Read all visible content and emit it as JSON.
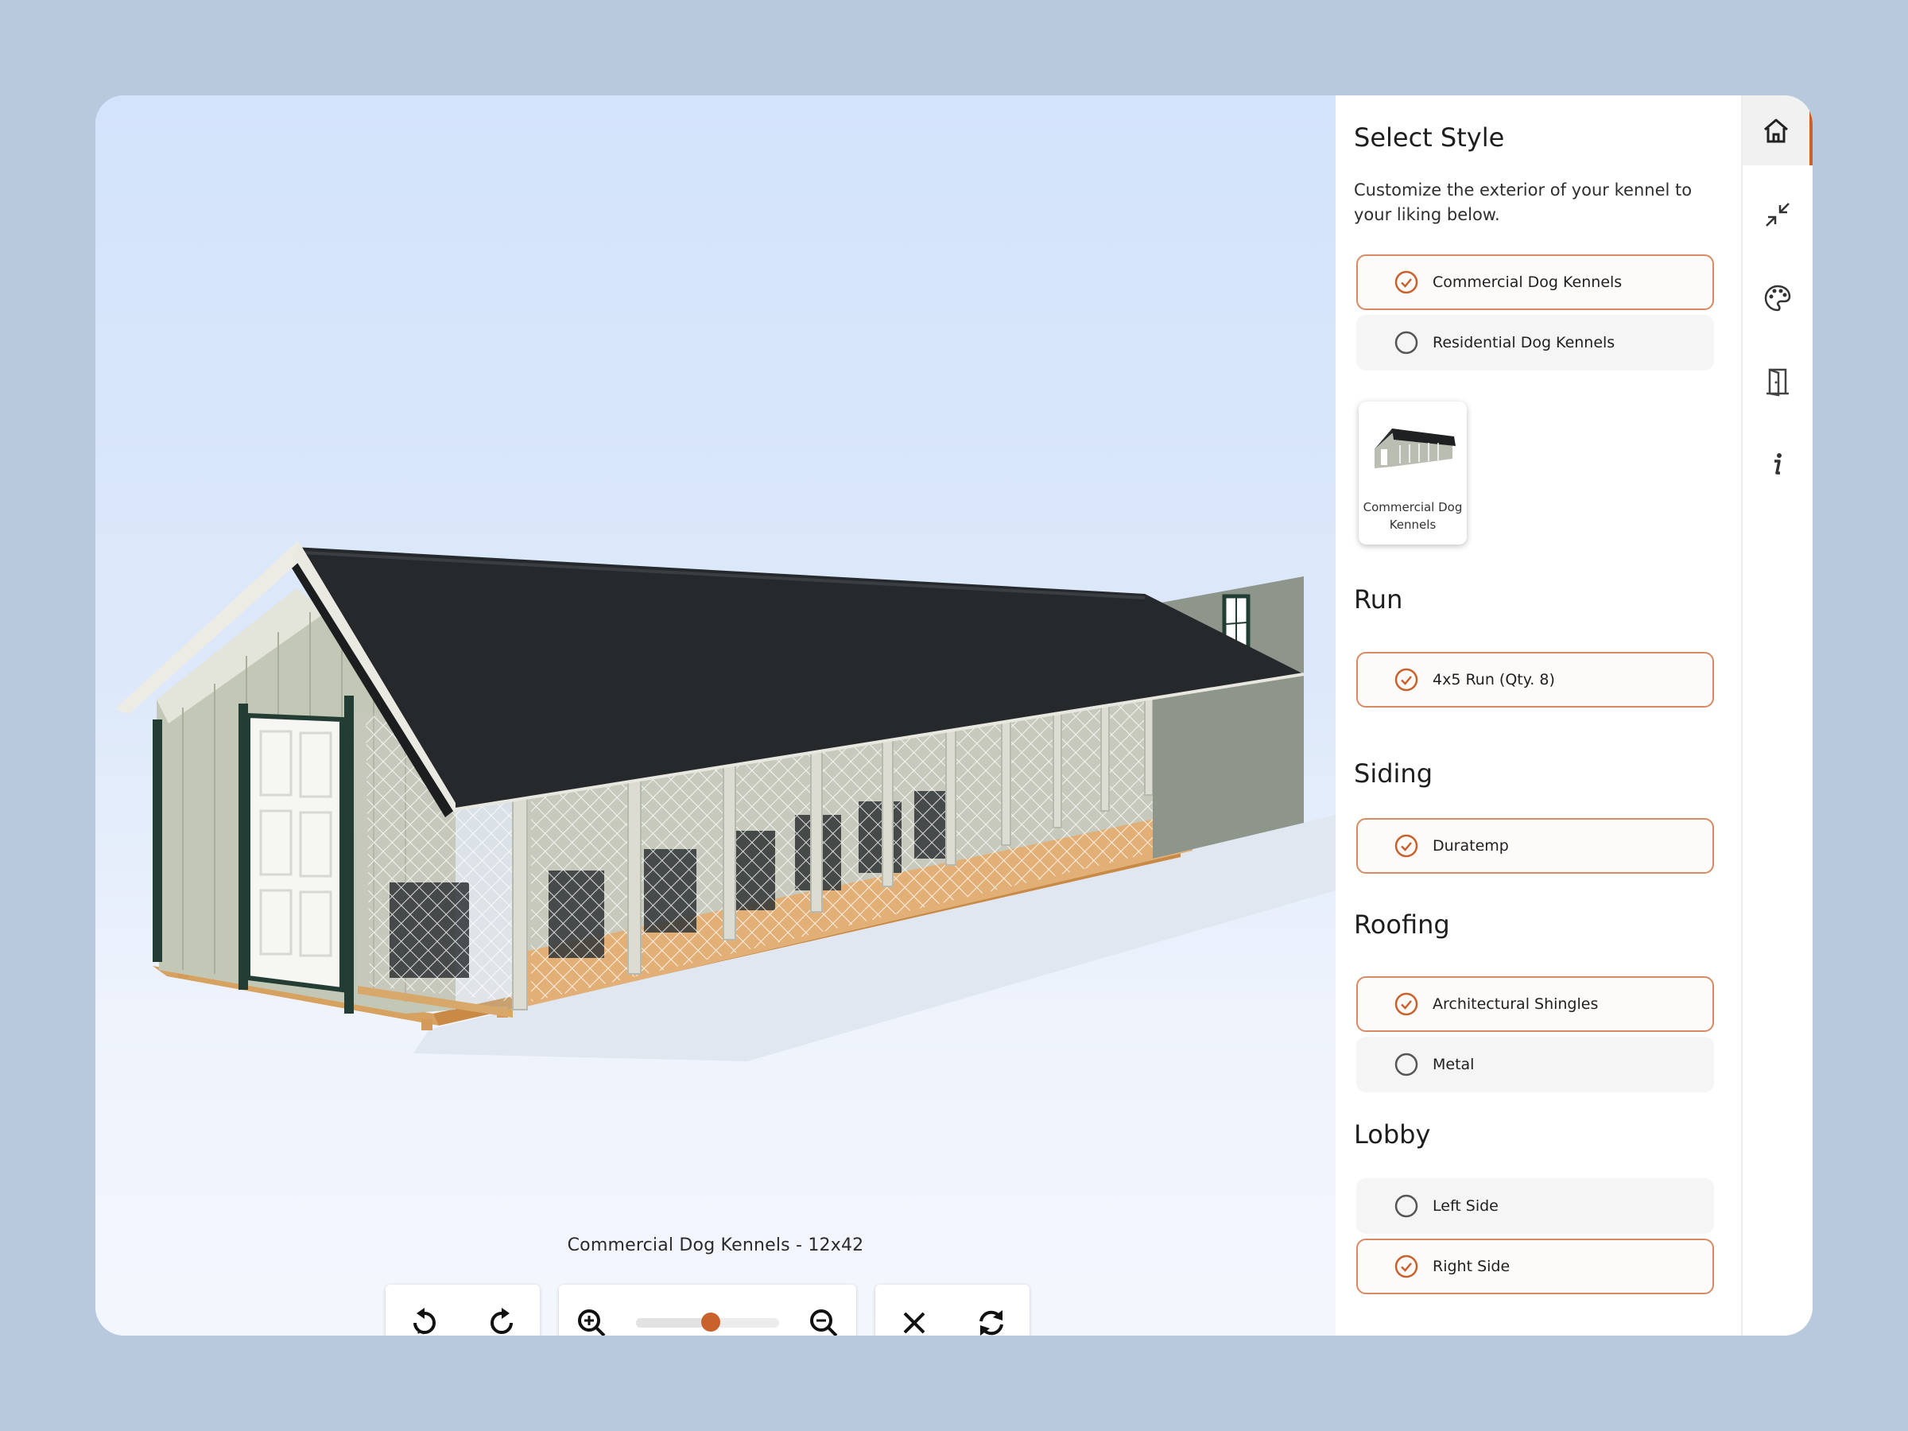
{
  "viewer": {
    "caption": "Commercial Dog Kennels - 12x42",
    "toolbar": {
      "rotate_left_icon": "rotate-left-icon",
      "rotate_right_icon": "rotate-right-icon",
      "zoom_in_icon": "zoom-in-icon",
      "zoom_out_icon": "zoom-out-icon",
      "zoom_level": 0.52,
      "close_icon": "close-icon",
      "reset_icon": "refresh-icon"
    }
  },
  "panel": {
    "style_title": "Select Style",
    "style_intro": "Customize the exterior of your kennel to your liking below.",
    "style_options": [
      {
        "label": "Commercial Dog Kennels",
        "selected": true
      },
      {
        "label": "Residential Dog Kennels",
        "selected": false
      }
    ],
    "model_thumb": {
      "label": "Commercial Dog Kennels"
    },
    "run": {
      "title": "Run",
      "options": [
        {
          "label": "4x5 Run (Qty. 8)",
          "selected": true
        }
      ]
    },
    "siding": {
      "title": "Siding",
      "options": [
        {
          "label": "Duratemp",
          "selected": true
        }
      ]
    },
    "roofing": {
      "title": "Roofing",
      "options": [
        {
          "label": "Architectural Shingles",
          "selected": true
        },
        {
          "label": "Metal",
          "selected": false
        }
      ]
    },
    "lobby": {
      "title": "Lobby",
      "options": [
        {
          "label": "Left Side",
          "selected": false
        },
        {
          "label": "Right Side",
          "selected": true
        }
      ]
    }
  },
  "rail": {
    "items": [
      {
        "icon": "home-icon",
        "active": true
      },
      {
        "icon": "collapse-icon",
        "active": false
      },
      {
        "icon": "palette-icon",
        "active": false
      },
      {
        "icon": "door-icon",
        "active": false
      },
      {
        "icon": "info-icon",
        "active": false
      }
    ]
  },
  "colors": {
    "accent": "#c8612b",
    "selected_border": "#d88a63",
    "page_background": "#b9c9dd"
  }
}
